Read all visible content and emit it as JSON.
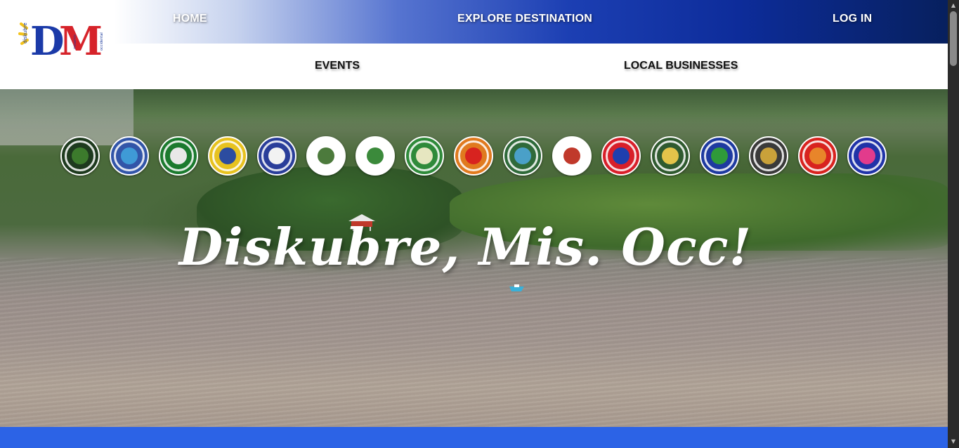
{
  "logo": {
    "letters": "DM",
    "left_tag": "diskubre",
    "sub_tag1": "misamis",
    "sub_tag2": "occidental"
  },
  "nav_top": {
    "home": "HOME",
    "explore": "EXPLORE DESTINATION",
    "login": "LOG IN"
  },
  "nav_sub": {
    "events": "EVENTS",
    "businesses": "LOCAL BUSINESSES"
  },
  "hero": {
    "title": "Diskubre, Mis. Occ!"
  },
  "seals": [
    {
      "name": "seal-1",
      "rim": "#1e3a1e",
      "core": "#3c7a2c"
    },
    {
      "name": "seal-baliangao",
      "rim": "#3255a8",
      "core": "#3f9ad6"
    },
    {
      "name": "seal-bonifacio",
      "rim": "#1b7a2e",
      "core": "#e8e8e8"
    },
    {
      "name": "seal-calamba",
      "rim": "#e7c21f",
      "core": "#2c4ca0"
    },
    {
      "name": "seal-clarin",
      "rim": "#2a3e9a",
      "core": "#f2f2f2"
    },
    {
      "name": "seal-concepcion",
      "rim": "#ffffff",
      "core": "#4c7a3c"
    },
    {
      "name": "seal-don-victoriano",
      "rim": "#ffffff",
      "core": "#3b8a3b"
    },
    {
      "name": "seal-jimenez",
      "rim": "#2f8a3a",
      "core": "#e6e6c0"
    },
    {
      "name": "seal-province",
      "rim": "#e07a1f",
      "core": "#d8231f"
    },
    {
      "name": "seal-lopez-jaena",
      "rim": "#2f6a3a",
      "core": "#4aa0c8"
    },
    {
      "name": "seal-oroquieta",
      "rim": "#ffffff",
      "core": "#c0392b"
    },
    {
      "name": "seal-ozamiz",
      "rim": "#d81f2a",
      "core": "#1f3fae"
    },
    {
      "name": "seal-plaridel",
      "rim": "#2f5a2f",
      "core": "#e3c34a"
    },
    {
      "name": "seal-sapang-dalaga",
      "rim": "#1e3aa0",
      "core": "#2f9a3a"
    },
    {
      "name": "seal-sinacaban",
      "rim": "#3a3a3a",
      "core": "#c9a13a"
    },
    {
      "name": "seal-tangub",
      "rim": "#d8231f",
      "core": "#e8852a"
    },
    {
      "name": "seal-tudela",
      "rim": "#2033a8",
      "core": "#e23b8c"
    }
  ],
  "colors": {
    "bottom_band": "#2c63e6",
    "nav_dark": "#07205e"
  }
}
